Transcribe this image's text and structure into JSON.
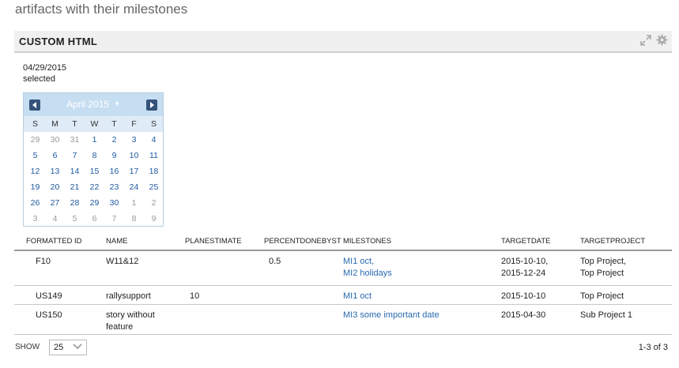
{
  "page": {
    "title": "artifacts with their milestones"
  },
  "panel": {
    "title": "CUSTOM HTML",
    "icons": [
      "expand-icon",
      "gear-icon"
    ]
  },
  "selection": {
    "date": "04/29/2015",
    "status": "selected"
  },
  "calendar": {
    "month_label": "April 2015",
    "day_headers": [
      "S",
      "M",
      "T",
      "W",
      "T",
      "F",
      "S"
    ],
    "weeks": [
      [
        "29",
        "30",
        "31",
        "1",
        "2",
        "3",
        "4"
      ],
      [
        "5",
        "6",
        "7",
        "8",
        "9",
        "10",
        "11"
      ],
      [
        "12",
        "13",
        "14",
        "15",
        "16",
        "17",
        "18"
      ],
      [
        "19",
        "20",
        "21",
        "22",
        "23",
        "24",
        "25"
      ],
      [
        "26",
        "27",
        "28",
        "29",
        "30",
        "1",
        "2"
      ],
      [
        "3",
        "4",
        "5",
        "6",
        "7",
        "8",
        "9"
      ]
    ],
    "other_month": [
      [
        true,
        true,
        true,
        false,
        false,
        false,
        false
      ],
      [
        false,
        false,
        false,
        false,
        false,
        false,
        false
      ],
      [
        false,
        false,
        false,
        false,
        false,
        false,
        false
      ],
      [
        false,
        false,
        false,
        false,
        false,
        false,
        false
      ],
      [
        false,
        false,
        false,
        false,
        false,
        true,
        true
      ],
      [
        true,
        true,
        true,
        true,
        true,
        true,
        true
      ]
    ],
    "colors": {
      "header_bg": "#c6def2",
      "nav_bg": "#35537a",
      "day_link": "#1e5aa0",
      "other_day": "#999999"
    }
  },
  "grid": {
    "columns": [
      "FORMATTED ID",
      "NAME",
      "PLANESTIMATE",
      "PERCENTDONEBYST",
      "MILESTONES",
      "TARGETDATE",
      "TARGETPROJECT"
    ],
    "rows": [
      {
        "id": "F10",
        "name": [
          "W11&12"
        ],
        "plan_estimate": "",
        "percent_done": "0.5",
        "milestones": [
          "MI1 oct,",
          "MI2 holidays"
        ],
        "target_date": [
          "2015-10-10,",
          "2015-12-24"
        ],
        "target_project": [
          "Top Project,",
          "Top Project"
        ]
      },
      {
        "id": "US149",
        "name": [
          "rallysupport"
        ],
        "plan_estimate": "10",
        "percent_done": "",
        "milestones": [
          "MI1 oct"
        ],
        "target_date": [
          "2015-10-10"
        ],
        "target_project": [
          "Top Project"
        ]
      },
      {
        "id": "US150",
        "name": [
          "story without",
          "feature"
        ],
        "plan_estimate": "",
        "percent_done": "",
        "milestones": [
          "MI3 some important date"
        ],
        "target_date": [
          "2015-04-30"
        ],
        "target_project": [
          "Sub Project 1"
        ]
      }
    ]
  },
  "footer": {
    "show_label": "SHOW",
    "page_size": "25",
    "paging_text": "1-3 of 3"
  },
  "colors": {
    "link": "#2a6ab0",
    "panel_header_bg": "#f0f0f0",
    "title_text": "#666666"
  }
}
